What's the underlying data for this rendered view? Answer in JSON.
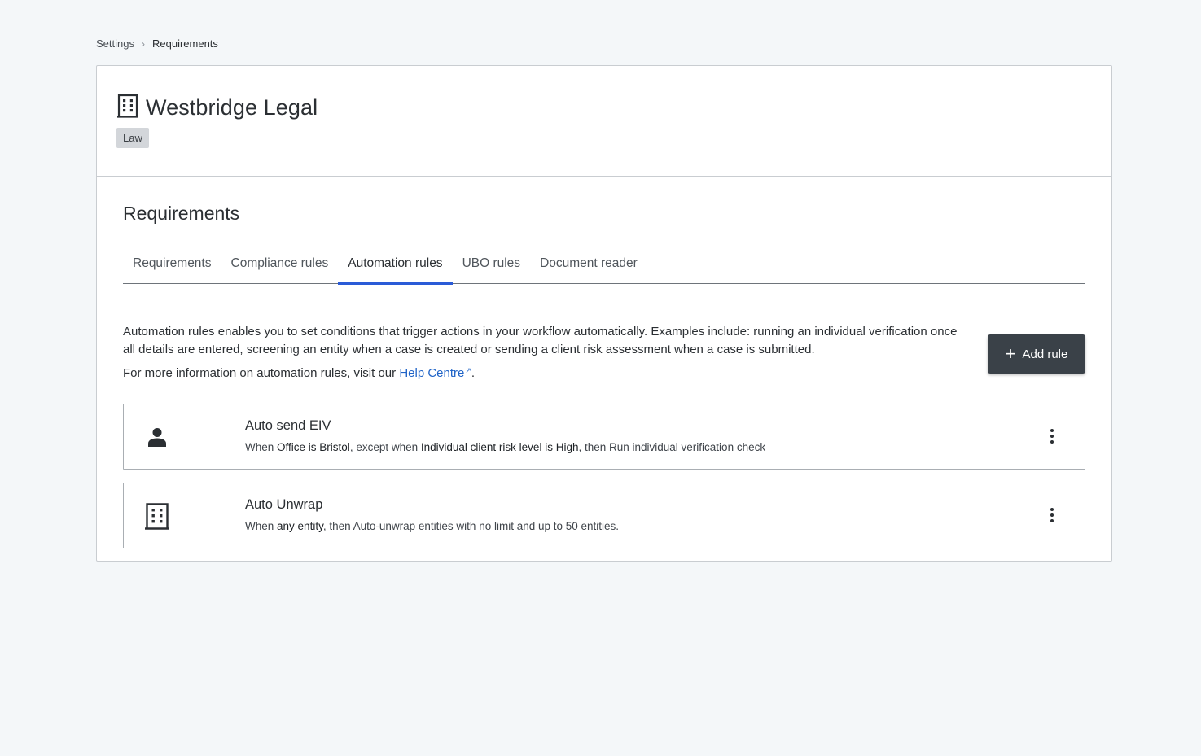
{
  "breadcrumb": {
    "parent": "Settings",
    "separator": "›",
    "current": "Requirements"
  },
  "organisation": {
    "name": "Westbridge Legal",
    "tag": "Law",
    "icon": "building-icon"
  },
  "section": {
    "title": "Requirements"
  },
  "tabs": [
    {
      "label": "Requirements",
      "active": false
    },
    {
      "label": "Compliance rules",
      "active": false
    },
    {
      "label": "Automation rules",
      "active": true
    },
    {
      "label": "UBO rules",
      "active": false
    },
    {
      "label": "Document reader",
      "active": false
    }
  ],
  "intro": {
    "description": "Automation rules enables you to set conditions that trigger actions in your workflow automatically. Examples include: running an individual verification once all details are entered, screening an entity when a case is created or sending a client risk assessment when a case is submitted.",
    "more_prefix": "For more information on automation rules, visit our ",
    "link_label": "Help Centre",
    "external_glyph": "↗",
    "more_suffix": "."
  },
  "add_rule": {
    "icon": "plus-icon",
    "label": "Add rule"
  },
  "rules": [
    {
      "icon": "person-icon",
      "name": "Auto send EIV",
      "parts": [
        "When ",
        "Office is Bristol",
        ", except when ",
        "Individual client risk level is High",
        ", then Run individual verification check"
      ]
    },
    {
      "icon": "building-icon",
      "name": "Auto Unwrap",
      "parts": [
        "When ",
        "any entity",
        ", then Auto-unwrap entities with no limit and up to 50 entities."
      ]
    }
  ],
  "colors": {
    "accent": "#2a5bd7",
    "button_bg": "#3a4148",
    "link": "#1f63c7",
    "page_bg": "#f4f7f9"
  }
}
